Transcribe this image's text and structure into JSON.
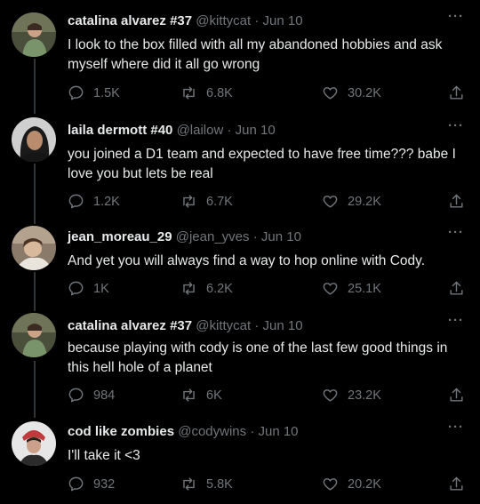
{
  "tweets": [
    {
      "name": "catalina alvarez #37",
      "handle": "@kittycat",
      "dot": "·",
      "date": "Jun 10",
      "more": "···",
      "text": "I look to the box filled with all my abandoned hobbies and ask myself where did it all go wrong",
      "replies": "1.5K",
      "retweets": "6.8K",
      "likes": "30.2K"
    },
    {
      "name": "laila dermott #40",
      "handle": "@lailow",
      "dot": "·",
      "date": "Jun 10",
      "more": "···",
      "text": "you joined a D1 team and expected to have free time??? babe I love you but lets be real",
      "replies": "1.2K",
      "retweets": "6.7K",
      "likes": "29.2K"
    },
    {
      "name": "jean_moreau_29",
      "handle": "@jean_yves",
      "dot": "·",
      "date": "Jun 10",
      "more": "···",
      "text": "And yet you will always find a way to hop online with Cody.",
      "replies": "1K",
      "retweets": "6.2K",
      "likes": "25.1K"
    },
    {
      "name": "catalina alvarez #37",
      "handle": "@kittycat",
      "dot": "·",
      "date": "Jun 10",
      "more": "···",
      "text": "because playing with cody is one of the last few good things in this hell hole of a planet",
      "replies": "984",
      "retweets": "6K",
      "likes": "23.2K"
    },
    {
      "name": "cod like zombies",
      "handle": "@codywins",
      "dot": "·",
      "date": "Jun 10",
      "more": "···",
      "text": "I'll take it <3",
      "replies": "932",
      "retweets": "5.8K",
      "likes": "20.2K"
    }
  ],
  "icons": {
    "reply": "reply-icon",
    "retweet": "retweet-icon",
    "like": "heart-icon",
    "share": "share-icon",
    "more": "more-icon"
  },
  "colors": {
    "background": "#000000",
    "text": "#e7e9ea",
    "muted": "#71767b",
    "thread_line": "#333639"
  }
}
